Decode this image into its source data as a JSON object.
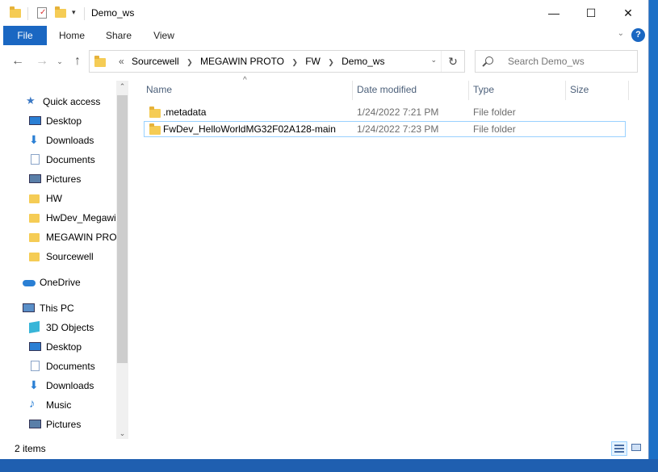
{
  "window": {
    "title": "Demo_ws",
    "minimize": "—",
    "maximize": "☐",
    "close": "✕"
  },
  "ribbon": {
    "tabs": [
      "File",
      "Home",
      "Share",
      "View"
    ],
    "help": "?"
  },
  "address": {
    "prefix": "«",
    "crumbs": [
      "Sourcewell",
      "MEGAWIN PROTO",
      "FW",
      "Demo_ws"
    ]
  },
  "search": {
    "placeholder": "Search Demo_ws"
  },
  "sidebar": {
    "items": [
      {
        "label": "Quick access",
        "icon": "star-icon",
        "pinned": false
      },
      {
        "label": "Desktop",
        "icon": "desktop-icon",
        "pinned": true
      },
      {
        "label": "Downloads",
        "icon": "download-icon",
        "pinned": true
      },
      {
        "label": "Documents",
        "icon": "document-icon",
        "pinned": true
      },
      {
        "label": "Pictures",
        "icon": "pictures-icon",
        "pinned": true
      },
      {
        "label": "HW",
        "icon": "folder-icon",
        "pinned": false
      },
      {
        "label": "HwDev_Megawi",
        "icon": "folder-icon",
        "pinned": false
      },
      {
        "label": "MEGAWIN PROT",
        "icon": "folder-icon",
        "pinned": false
      },
      {
        "label": "Sourcewell",
        "icon": "folder-icon",
        "pinned": false
      },
      {
        "label": "OneDrive",
        "icon": "cloud-icon",
        "pinned": false
      },
      {
        "label": "This PC",
        "icon": "computer-icon",
        "pinned": false
      },
      {
        "label": "3D Objects",
        "icon": "cube-icon",
        "pinned": false
      },
      {
        "label": "Desktop",
        "icon": "desktop-icon",
        "pinned": false
      },
      {
        "label": "Documents",
        "icon": "document-icon",
        "pinned": false
      },
      {
        "label": "Downloads",
        "icon": "download-icon",
        "pinned": false
      },
      {
        "label": "Music",
        "icon": "music-icon",
        "pinned": false
      },
      {
        "label": "Pictures",
        "icon": "pictures-icon",
        "pinned": false
      }
    ]
  },
  "columns": {
    "name": "Name",
    "date": "Date modified",
    "type": "Type",
    "size": "Size"
  },
  "files": [
    {
      "name": ".metadata",
      "date": "1/24/2022 7:21 PM",
      "type": "File folder",
      "size": ""
    },
    {
      "name": "FwDev_HelloWorldMG32F02A128-main",
      "date": "1/24/2022 7:23 PM",
      "type": "File folder",
      "size": ""
    }
  ],
  "status": {
    "count": "2 items"
  },
  "colors": {
    "accent": "#1a67c2",
    "folder": "#f5cc55",
    "selection_border": "#99d1ff"
  }
}
